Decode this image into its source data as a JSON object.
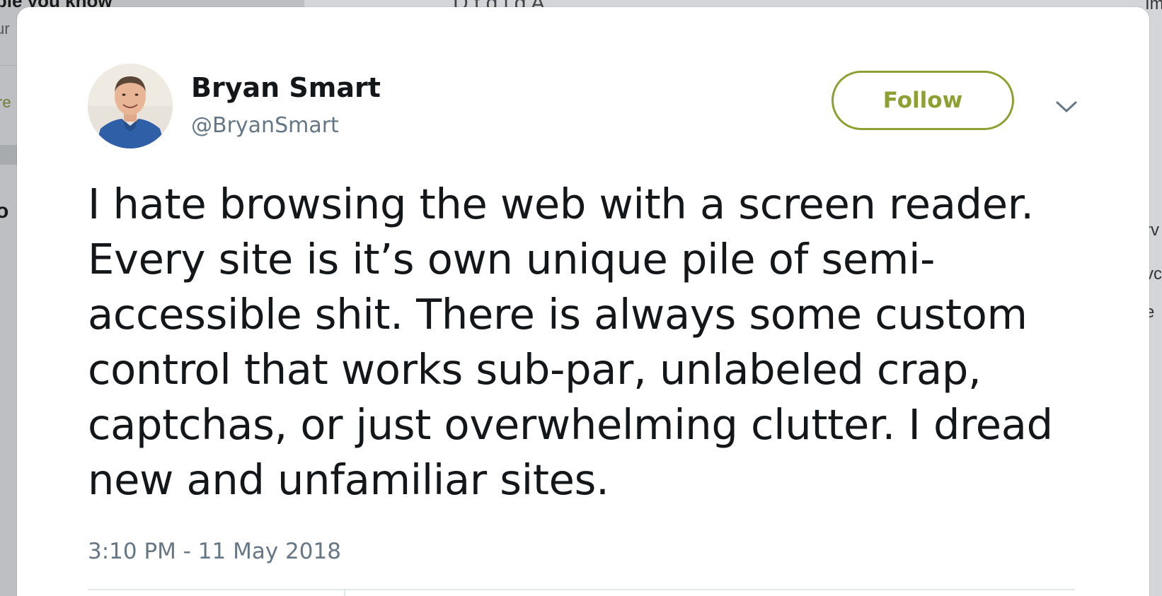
{
  "background": {
    "left_heading": "ople you know",
    "left_sub": "ur",
    "left_link": "re",
    "left_bold": "o",
    "top_text": "D     t    d     l   d    A",
    "right_fragments": [
      "rv",
      "vc",
      "e"
    ],
    "right_top": "Im"
  },
  "tweet": {
    "author_name": "Bryan Smart",
    "author_handle": "@BryanSmart",
    "follow_label": "Follow",
    "text": "I hate browsing the web with a screen reader. Every site is it’s own unique pile of semi-accessible shit. There is always some custom control that works sub-par, unlabeled crap, captchas, or just overwhelming clutter. I dread new and unfamiliar sites.",
    "timestamp": "3:10 PM - 11 May 2018"
  },
  "colors": {
    "accent": "#8fa032",
    "text_primary": "#14171a",
    "text_secondary": "#657786",
    "divider": "#e1e8ed"
  },
  "icons": {
    "avatar": "profile-photo",
    "caret": "chevron-down-icon"
  }
}
